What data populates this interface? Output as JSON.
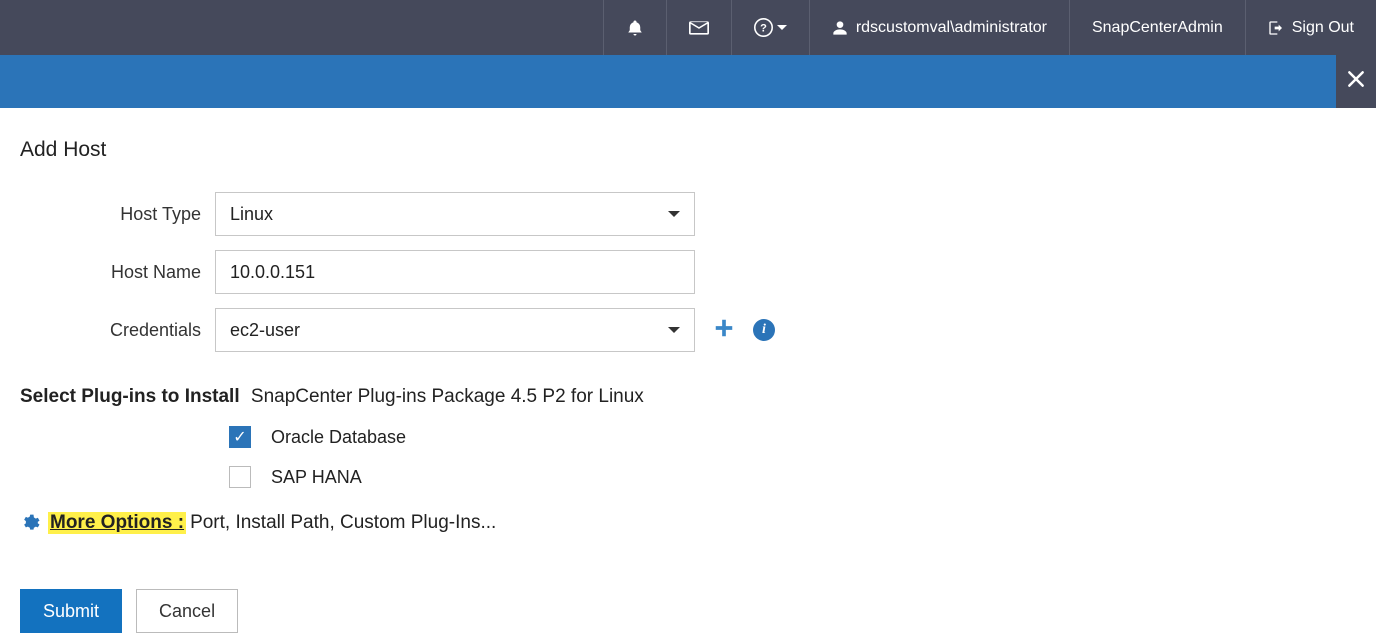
{
  "topbar": {
    "username": "rdscustomval\\administrator",
    "role": "SnapCenterAdmin",
    "signout": "Sign Out"
  },
  "page": {
    "title": "Add Host"
  },
  "form": {
    "host_type": {
      "label": "Host Type",
      "value": "Linux"
    },
    "host_name": {
      "label": "Host Name",
      "value": "10.0.0.151"
    },
    "credentials": {
      "label": "Credentials",
      "value": "ec2-user"
    }
  },
  "plugins": {
    "section_label": "Select Plug-ins to Install",
    "package_text": "SnapCenter Plug-ins Package 4.5 P2 for Linux",
    "options": [
      {
        "label": "Oracle Database",
        "checked": true
      },
      {
        "label": "SAP HANA",
        "checked": false
      }
    ]
  },
  "more_options": {
    "link": "More Options :",
    "suffix": "Port, Install Path, Custom Plug-Ins..."
  },
  "buttons": {
    "submit": "Submit",
    "cancel": "Cancel"
  }
}
